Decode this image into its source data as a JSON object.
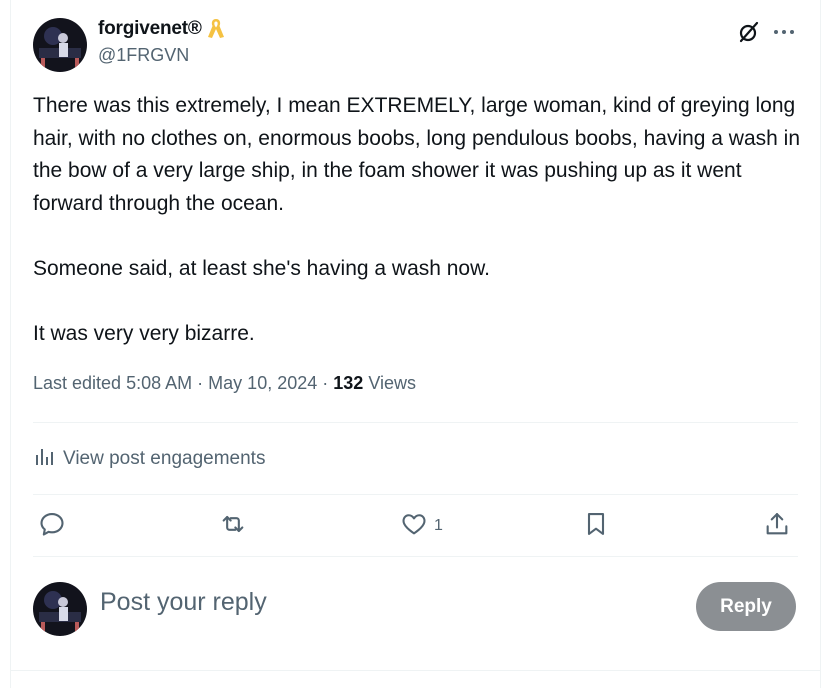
{
  "author": {
    "display_name": "forgivenet®",
    "handle": "@1FRGVN",
    "badge_icon": "yellow-ribbon-icon"
  },
  "post": {
    "paragraphs": [
      "There was this extremely, I mean EXTREMELY, large woman, kind of greying long hair, with no clothes on, enormous boobs, long pendulous boobs, having a wash in the bow of a very large ship, in the foam shower it was pushing up as it went forward through the ocean.",
      "Someone said, at least she's having a wash now.",
      "It was very very bizarre."
    ]
  },
  "meta": {
    "edited_prefix": "Last edited",
    "time": "5:08 AM",
    "separator": "·",
    "date": "May 10, 2024",
    "views_count": "132",
    "views_label": "Views"
  },
  "engagements": {
    "label": "View post engagements"
  },
  "actions": {
    "reply_count": "",
    "repost_count": "",
    "like_count": "1",
    "bookmark_count": ""
  },
  "composer": {
    "placeholder": "Post your reply",
    "button_label": "Reply"
  },
  "colors": {
    "text": "#0f1419",
    "secondary": "#536471",
    "divider": "#eff3f4",
    "reply_button_disabled": "#8b8f93",
    "ribbon": "#f5c242"
  }
}
